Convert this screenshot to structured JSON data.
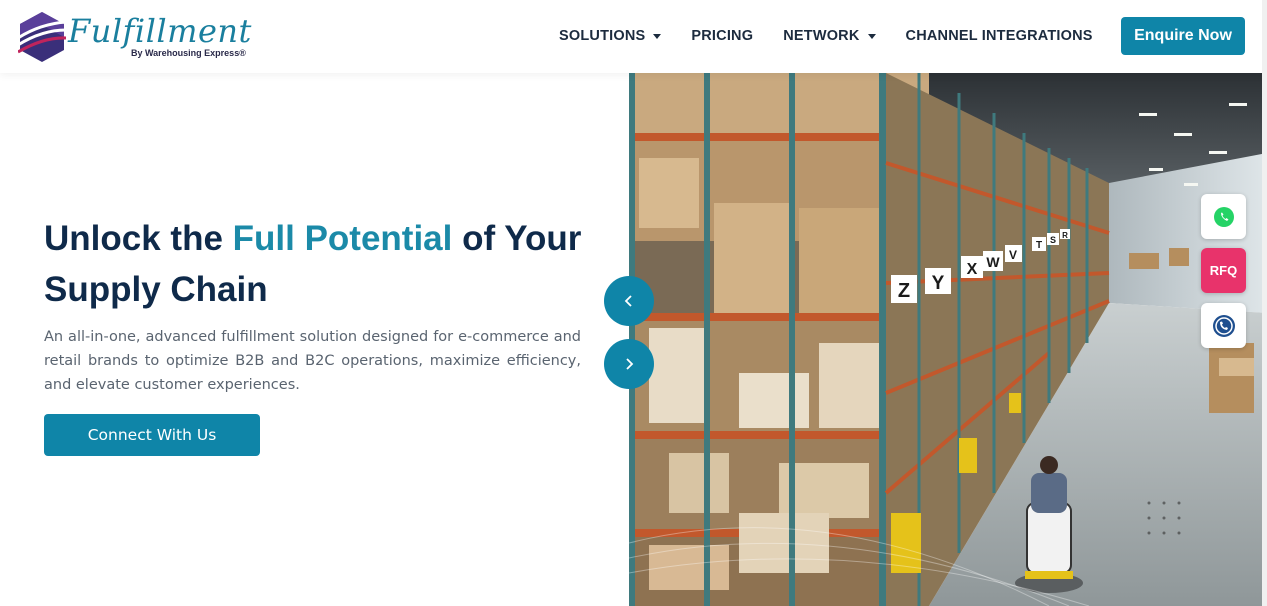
{
  "brand": {
    "name": "Fulfillment",
    "tagline": "By Warehousing Express®",
    "colors": {
      "primary": "#0f85a8",
      "accent_text": "#1b8aa8",
      "heading": "#0f2a4a",
      "rfq": "#e8336b"
    }
  },
  "nav": {
    "items": [
      {
        "label": "SOLUTIONS",
        "has_dropdown": true
      },
      {
        "label": "PRICING",
        "has_dropdown": false
      },
      {
        "label": "NETWORK",
        "has_dropdown": true
      },
      {
        "label": "CHANNEL INTEGRATIONS",
        "has_dropdown": false
      }
    ],
    "cta_label": "Enquire Now"
  },
  "hero": {
    "title_part1": "Unlock the ",
    "title_accent": "Full Potential",
    "title_part2": " of Your Supply Chain",
    "description": "An all-in-one, advanced fulfillment solution designed for e-commerce and retail brands to optimize B2B and B2C operations, maximize efficiency, and elevate customer experiences.",
    "cta_label": "Connect With Us",
    "image_icon": "warehouse-photo",
    "aisle_signs": [
      "Z",
      "Y",
      "X",
      "W",
      "V",
      "T",
      "S",
      "R"
    ]
  },
  "slider": {
    "prev_icon": "chevron-left-icon",
    "next_icon": "chevron-right-icon"
  },
  "floating": {
    "whatsapp_icon": "whatsapp-icon",
    "rfq_label": "RFQ",
    "call_icon": "phone-icon"
  }
}
